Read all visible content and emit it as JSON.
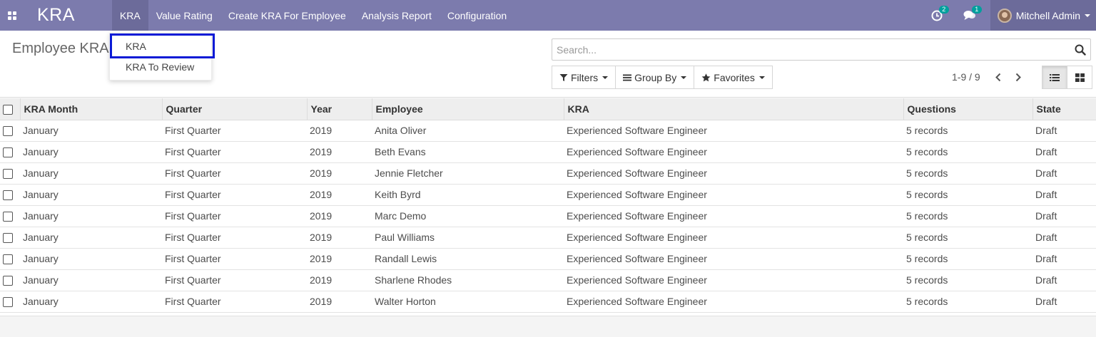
{
  "navbar": {
    "brand": "KRA",
    "menu": [
      "KRA",
      "Value Rating",
      "Create KRA For Employee",
      "Analysis Report",
      "Configuration"
    ],
    "activity_count": "2",
    "messages_count": "1",
    "user_name": "Mitchell Admin"
  },
  "dropdown": {
    "items": [
      "KRA",
      "KRA To Review"
    ]
  },
  "control": {
    "breadcrumb": "Employee KRA",
    "search_placeholder": "Search...",
    "filters_label": "Filters",
    "groupby_label": "Group By",
    "favorites_label": "Favorites",
    "pager": "1-9 / 9"
  },
  "table": {
    "columns": [
      "KRA Month",
      "Quarter",
      "Year",
      "Employee",
      "KRA",
      "Questions",
      "State"
    ],
    "rows": [
      [
        "January",
        "First Quarter",
        "2019",
        "Anita Oliver",
        "Experienced Software Engineer",
        "5 records",
        "Draft"
      ],
      [
        "January",
        "First Quarter",
        "2019",
        "Beth Evans",
        "Experienced Software Engineer",
        "5 records",
        "Draft"
      ],
      [
        "January",
        "First Quarter",
        "2019",
        "Jennie Fletcher",
        "Experienced Software Engineer",
        "5 records",
        "Draft"
      ],
      [
        "January",
        "First Quarter",
        "2019",
        "Keith Byrd",
        "Experienced Software Engineer",
        "5 records",
        "Draft"
      ],
      [
        "January",
        "First Quarter",
        "2019",
        "Marc Demo",
        "Experienced Software Engineer",
        "5 records",
        "Draft"
      ],
      [
        "January",
        "First Quarter",
        "2019",
        "Paul Williams",
        "Experienced Software Engineer",
        "5 records",
        "Draft"
      ],
      [
        "January",
        "First Quarter",
        "2019",
        "Randall Lewis",
        "Experienced Software Engineer",
        "5 records",
        "Draft"
      ],
      [
        "January",
        "First Quarter",
        "2019",
        "Sharlene Rhodes",
        "Experienced Software Engineer",
        "5 records",
        "Draft"
      ],
      [
        "January",
        "First Quarter",
        "2019",
        "Walter Horton",
        "Experienced Software Engineer",
        "5 records",
        "Draft"
      ]
    ]
  },
  "colors": {
    "navbar": "#7c7bad",
    "navbar_active": "#6c6b9a",
    "badge": "#00a09d",
    "highlight": "#0a1ad6"
  }
}
